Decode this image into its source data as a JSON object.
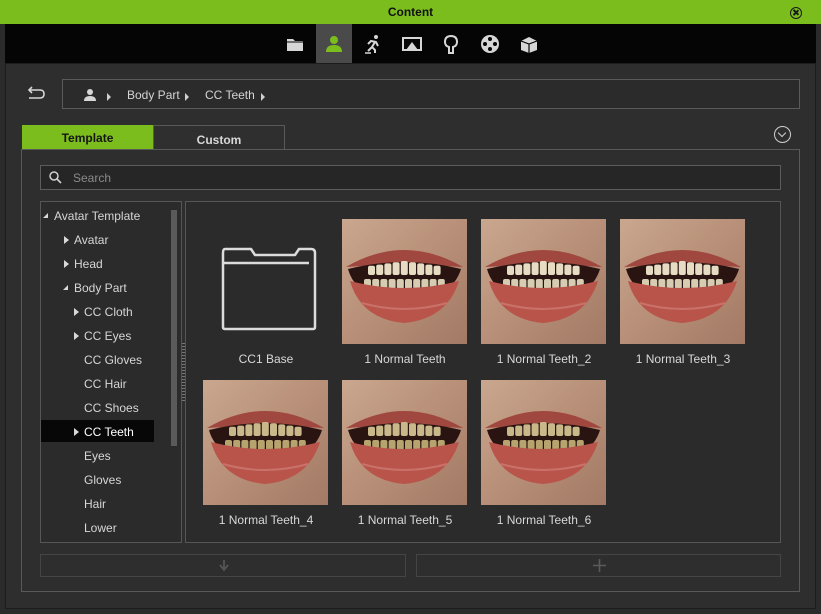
{
  "window": {
    "title": "Content"
  },
  "toolbar": {
    "tools": [
      {
        "icon": "folder-icon",
        "name": "project"
      },
      {
        "icon": "avatar-icon",
        "name": "actor",
        "active": true
      },
      {
        "icon": "motion-icon",
        "name": "animation"
      },
      {
        "icon": "stage-icon",
        "name": "stage"
      },
      {
        "icon": "tree-icon",
        "name": "set"
      },
      {
        "icon": "film-reel-icon",
        "name": "media"
      },
      {
        "icon": "box-icon",
        "name": "custom"
      }
    ]
  },
  "breadcrumb": {
    "items": [
      "Body Part",
      "CC Teeth"
    ]
  },
  "tabs": {
    "template": "Template",
    "custom": "Custom"
  },
  "search": {
    "placeholder": "Search"
  },
  "tree": {
    "items": [
      {
        "label": "Avatar Template",
        "level": 0,
        "state": "open"
      },
      {
        "label": "Avatar",
        "level": 1,
        "state": "closed"
      },
      {
        "label": "Head",
        "level": 1,
        "state": "closed"
      },
      {
        "label": "Body Part",
        "level": 1,
        "state": "open"
      },
      {
        "label": "CC Cloth",
        "level": 2,
        "state": "closed"
      },
      {
        "label": "CC Eyes",
        "level": 2,
        "state": "closed"
      },
      {
        "label": "CC Gloves",
        "level": 2,
        "state": "leaf"
      },
      {
        "label": "CC Hair",
        "level": 2,
        "state": "leaf"
      },
      {
        "label": "CC Shoes",
        "level": 2,
        "state": "leaf"
      },
      {
        "label": "CC Teeth",
        "level": 2,
        "state": "closed",
        "selected": true
      },
      {
        "label": "Eyes",
        "level": 2,
        "state": "leaf"
      },
      {
        "label": "Gloves",
        "level": 2,
        "state": "leaf"
      },
      {
        "label": "Hair",
        "level": 2,
        "state": "leaf"
      },
      {
        "label": "Lower",
        "level": 2,
        "state": "leaf"
      }
    ]
  },
  "grid": {
    "items": [
      {
        "label": "CC1 Base",
        "kind": "folder"
      },
      {
        "label": "1 Normal Teeth",
        "kind": "teeth"
      },
      {
        "label": "1 Normal Teeth_2",
        "kind": "teeth"
      },
      {
        "label": "1 Normal Teeth_3",
        "kind": "teeth"
      },
      {
        "label": "1 Normal Teeth_4",
        "kind": "teeth-yellow"
      },
      {
        "label": "1 Normal Teeth_5",
        "kind": "teeth-yellow"
      },
      {
        "label": "1 Normal Teeth_6",
        "kind": "teeth-yellow"
      }
    ]
  },
  "colors": {
    "accent": "#7cbd1e",
    "panel": "#2e2e2e",
    "toolbar": "#050505"
  },
  "buttons": {
    "download_icon": "download-icon",
    "add_icon": "plus-icon"
  }
}
